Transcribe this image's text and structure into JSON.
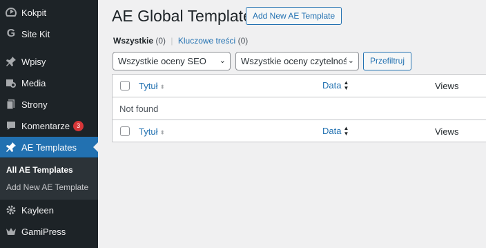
{
  "sidebar": {
    "items": [
      {
        "label": "Kokpit",
        "icon": "dashboard-icon"
      },
      {
        "label": "Site Kit",
        "icon": "google-g-icon"
      },
      {
        "label": "Wpisy",
        "icon": "pushpin-icon"
      },
      {
        "label": "Media",
        "icon": "media-icon"
      },
      {
        "label": "Strony",
        "icon": "pages-icon"
      },
      {
        "label": "Komentarze",
        "icon": "comment-icon",
        "badge": "3"
      },
      {
        "label": "AE Templates",
        "icon": "pushpin-icon",
        "active": true
      },
      {
        "label": "Kayleen",
        "icon": "gear-icon"
      },
      {
        "label": "GamiPress",
        "icon": "crown-icon"
      }
    ],
    "submenu": [
      {
        "label": "All AE Templates",
        "current": true
      },
      {
        "label": "Add New AE Template"
      }
    ]
  },
  "header": {
    "title": "AE Global Templates",
    "add_new_label": "Add New AE Template"
  },
  "views": {
    "all_label": "Wszystkie",
    "all_count": "(0)",
    "separator": "|",
    "cornerstone_label": "Kluczowe treści",
    "cornerstone_count": "(0)"
  },
  "filters": {
    "seo_select": "Wszystkie oceny SEO",
    "readability_select": "Wszystkie oceny czytelności",
    "filter_button": "Przefiltruj"
  },
  "table": {
    "columns": {
      "title": "Tytuł",
      "date": "Data",
      "views": "Views"
    },
    "empty_message": "Not found"
  },
  "colors": {
    "sidebar_bg": "#1d2327",
    "accent": "#2271b1",
    "badge": "#d63638",
    "page_bg": "#f0f0f1"
  }
}
